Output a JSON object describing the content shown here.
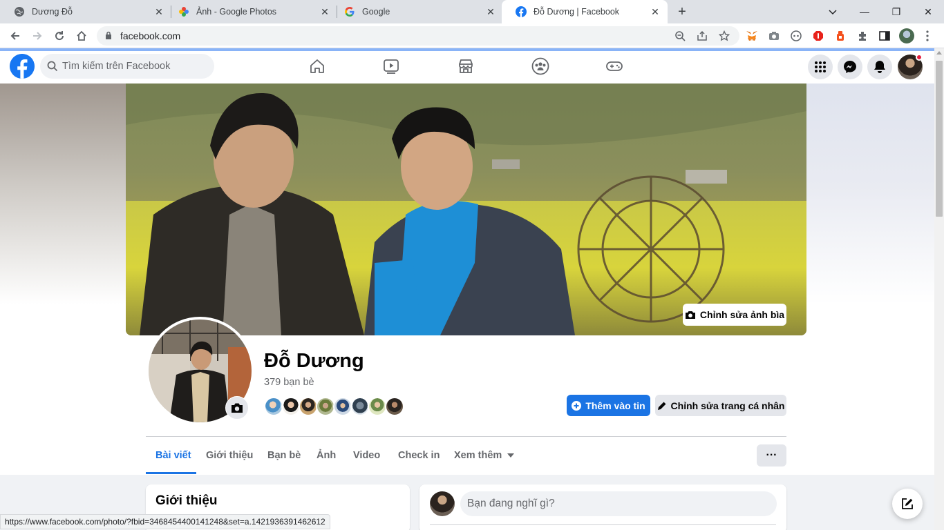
{
  "browser": {
    "tabs": [
      {
        "title": "Dương Đỗ",
        "icon": "globe-icon"
      },
      {
        "title": "Ảnh - Google Photos",
        "icon": "google-photos-icon"
      },
      {
        "title": "Google",
        "icon": "google-icon"
      },
      {
        "title": "Đỗ Dương | Facebook",
        "icon": "facebook-icon",
        "active": true
      }
    ],
    "url": "facebook.com",
    "status_url": "https://www.facebook.com/photo/?fbid=3468454400141248&set=a.1421936391462612"
  },
  "fb": {
    "search_placeholder": "Tìm kiếm trên Facebook",
    "nav": [
      "home-icon",
      "watch-icon",
      "marketplace-icon",
      "groups-icon",
      "gaming-icon"
    ],
    "brand_color": "#1877f2"
  },
  "profile": {
    "edit_cover_label": "Chỉnh sửa ảnh bìa",
    "name": "Đỗ Dương",
    "friends_count": "379 bạn bè",
    "add_story_label": "Thêm vào tin",
    "edit_profile_label": "Chỉnh sửa trang cá nhân",
    "tabs": [
      "Bài viết",
      "Giới thiệu",
      "Bạn bè",
      "Ảnh",
      "Video",
      "Check in",
      "Xem thêm"
    ],
    "more_label": "···"
  },
  "intro": {
    "title": "Giới thiệu"
  },
  "composer": {
    "placeholder": "Bạn đang nghĩ gì?"
  }
}
